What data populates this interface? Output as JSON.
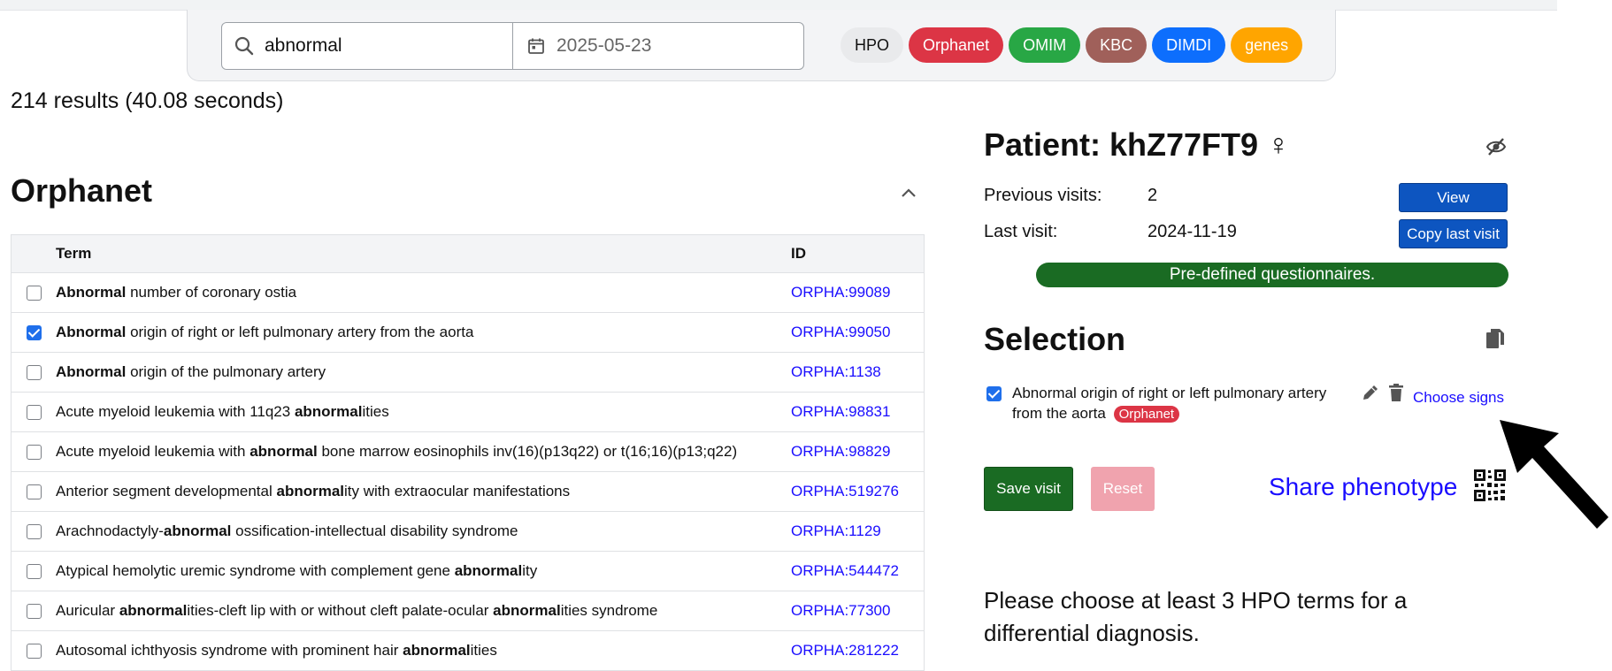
{
  "search": {
    "query": "abnormal",
    "date": "2025-05-23"
  },
  "filters": [
    {
      "label": "HPO",
      "color": "#e9eaec"
    },
    {
      "label": "Orphanet",
      "color": "#dc3545"
    },
    {
      "label": "OMIM",
      "color": "#28a745"
    },
    {
      "label": "KBC",
      "color": "#a0605a"
    },
    {
      "label": "DIMDI",
      "color": "#0d6efd"
    },
    {
      "label": "genes",
      "color": "#ffa500"
    }
  ],
  "results_summary": "214 results (40.08 seconds)",
  "section": {
    "title": "Orphanet",
    "table": {
      "headers": {
        "term": "Term",
        "id": "ID"
      },
      "rows": [
        {
          "checked": false,
          "term_parts": [
            [
              "Abnormal",
              true
            ],
            [
              " number of coronary ostia",
              false
            ]
          ],
          "id": "ORPHA:99089"
        },
        {
          "checked": true,
          "term_parts": [
            [
              "Abnormal",
              true
            ],
            [
              " origin of right or left pulmonary artery from the aorta",
              false
            ]
          ],
          "id": "ORPHA:99050"
        },
        {
          "checked": false,
          "term_parts": [
            [
              "Abnormal",
              true
            ],
            [
              " origin of the pulmonary artery",
              false
            ]
          ],
          "id": "ORPHA:1138"
        },
        {
          "checked": false,
          "term_parts": [
            [
              "Acute myeloid leukemia with 11q23 ",
              false
            ],
            [
              "abnormal",
              true
            ],
            [
              "ities",
              false
            ]
          ],
          "id": "ORPHA:98831"
        },
        {
          "checked": false,
          "term_parts": [
            [
              "Acute myeloid leukemia with ",
              false
            ],
            [
              "abnormal",
              true
            ],
            [
              " bone marrow eosinophils inv(16)(p13q22) or t(16;16)(p13;q22)",
              false
            ]
          ],
          "id": "ORPHA:98829"
        },
        {
          "checked": false,
          "term_parts": [
            [
              "Anterior segment developmental ",
              false
            ],
            [
              "abnormal",
              true
            ],
            [
              "ity with extraocular manifestations",
              false
            ]
          ],
          "id": "ORPHA:519276"
        },
        {
          "checked": false,
          "term_parts": [
            [
              "Arachnodactyly-",
              false
            ],
            [
              "abnormal",
              true
            ],
            [
              " ossification-intellectual disability syndrome",
              false
            ]
          ],
          "id": "ORPHA:1129"
        },
        {
          "checked": false,
          "term_parts": [
            [
              "Atypical hemolytic uremic syndrome with complement gene ",
              false
            ],
            [
              "abnormal",
              true
            ],
            [
              "ity",
              false
            ]
          ],
          "id": "ORPHA:544472"
        },
        {
          "checked": false,
          "term_parts": [
            [
              "Auricular ",
              false
            ],
            [
              "abnormal",
              true
            ],
            [
              "ities-cleft lip with or without cleft palate-ocular ",
              false
            ],
            [
              "abnormal",
              true
            ],
            [
              "ities syndrome",
              false
            ]
          ],
          "id": "ORPHA:77300"
        },
        {
          "checked": false,
          "term_parts": [
            [
              "Autosomal ichthyosis syndrome with prominent hair ",
              false
            ],
            [
              "abnormal",
              true
            ],
            [
              "ities",
              false
            ]
          ],
          "id": "ORPHA:281222"
        }
      ]
    }
  },
  "patient": {
    "title": "Patient: khZ77FT9",
    "gender_symbol": "♀",
    "previous_visits_label": "Previous visits:",
    "previous_visits_value": "2",
    "last_visit_label": "Last visit:",
    "last_visit_value": "2024-11-19",
    "view_button": "View",
    "copy_last_visit_button": "Copy last visit",
    "questionnaires_label": "Pre-defined questionnaires."
  },
  "selection": {
    "title": "Selection",
    "item_text": "Abnormal origin of right or left pulmonary artery from the aorta",
    "item_badge": "Orphanet",
    "choose_signs": "Choose signs"
  },
  "actions": {
    "save": "Save visit",
    "reset": "Reset",
    "share": "Share phenotype"
  },
  "hint": "Please choose at least 3 HPO terms for a differential diagnosis."
}
